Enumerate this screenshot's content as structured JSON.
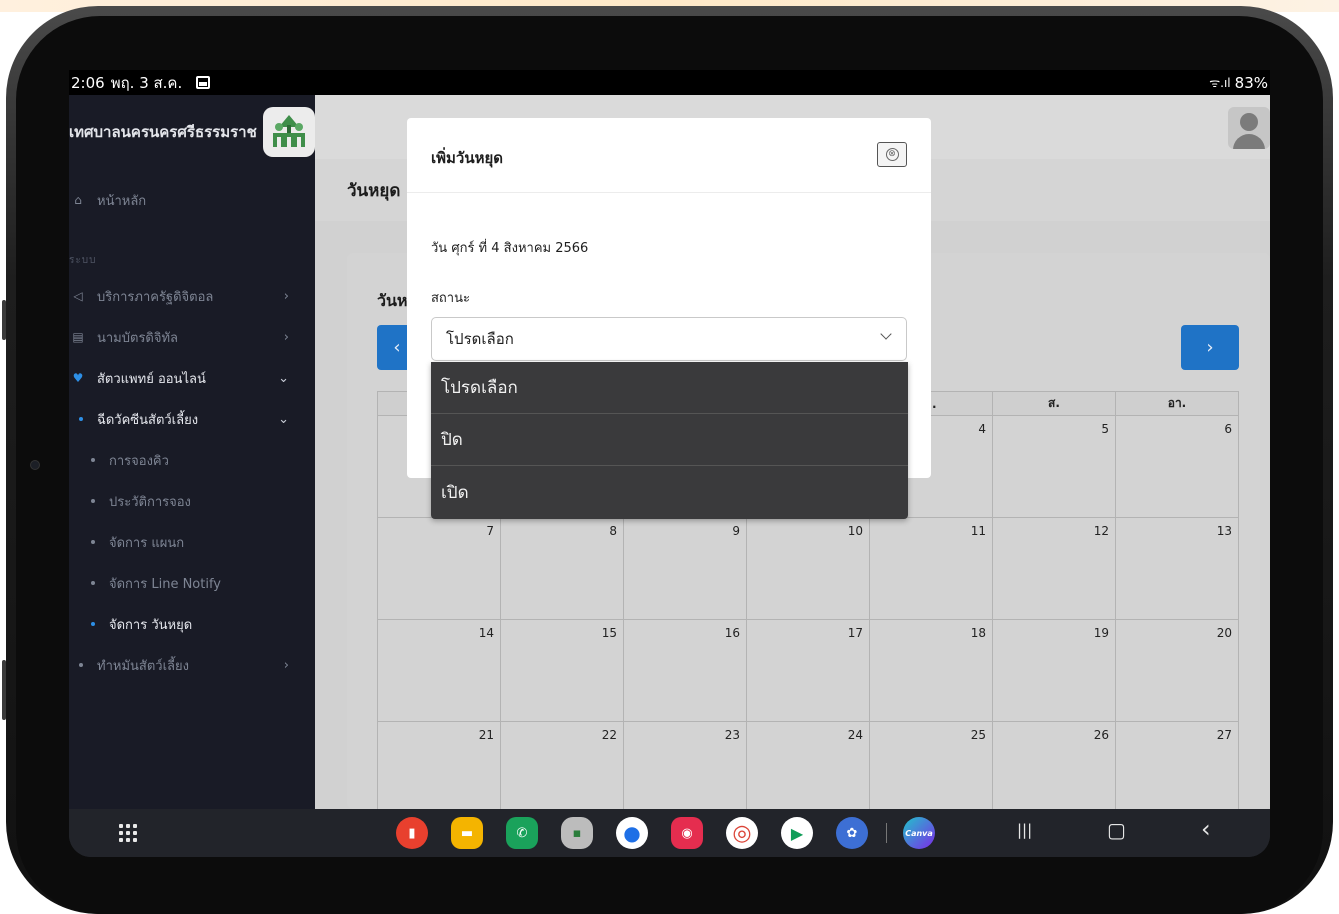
{
  "status_bar": {
    "time": "2:06",
    "date": "พฤ. 3 ส.ค.",
    "signal": "ᯤ.ıl",
    "battery": "83%"
  },
  "sidebar": {
    "brand": "เทศบาลนครนครศรีธรรมราช",
    "home": "หน้าหลัก",
    "section": "ระบบ",
    "items": [
      {
        "label": "บริการภาครัฐดิจิตอล",
        "expanded": false
      },
      {
        "label": "นามบัตรดิจิทัล",
        "expanded": false
      },
      {
        "label": "สัตวแพทย์ ออนไลน์",
        "expanded": true
      },
      {
        "label": "ฉีดวัคซีนสัตว์เลี้ยง",
        "expanded": true
      }
    ],
    "subitems": [
      "การจองคิว",
      "ประวัติการจอง",
      "จัดการ แผนก",
      "จัดการ Line Notify",
      "จัดการ วันหยุด"
    ],
    "last_item": "ทำหมันสัตว์เลี้ยง"
  },
  "page": {
    "title": "วันหยุด",
    "card_title": "วันห",
    "prev_label": "‹",
    "next_label": "›"
  },
  "calendar": {
    "headers": [
      "",
      "",
      "",
      "",
      ".",
      "ส.",
      "อา."
    ],
    "rows": [
      [
        "",
        "",
        "",
        "",
        "4",
        "5",
        "6"
      ],
      [
        "7",
        "8",
        "9",
        "10",
        "11",
        "12",
        "13"
      ],
      [
        "14",
        "15",
        "16",
        "17",
        "18",
        "19",
        "20"
      ],
      [
        "21",
        "22",
        "23",
        "24",
        "25",
        "26",
        "27"
      ]
    ]
  },
  "modal": {
    "title": "เพิ่มวันหยุด",
    "close_symbol": "⊗",
    "date_text": "วัน ศุกร์ ที่ 4 สิงหาคม 2566",
    "status_label": "สถานะ",
    "select_value": "โปรดเลือก",
    "options": [
      "โปรดเลือก",
      "ปิด",
      "เปิด"
    ]
  },
  "dock": {
    "canva_label": "Canva",
    "apps": [
      {
        "name": "notes",
        "color": "#e8402e",
        "glyph": "▮"
      },
      {
        "name": "files",
        "color": "#f4b400",
        "glyph": "▬"
      },
      {
        "name": "phone",
        "color": "#1aa25b",
        "glyph": "✆"
      },
      {
        "name": "gallery-group",
        "color": "#bcbcbc",
        "glyph": "▪"
      },
      {
        "name": "messages",
        "color": "#1e6fe6",
        "glyph": "●"
      },
      {
        "name": "camera",
        "color": "#e52d4f",
        "glyph": "◉"
      },
      {
        "name": "chrome",
        "color": "#ffffff",
        "glyph": "◎"
      },
      {
        "name": "play-store",
        "color": "#ffffff",
        "glyph": "▶"
      },
      {
        "name": "settings",
        "color": "#3d6fd4",
        "glyph": "✿"
      }
    ],
    "recents": "|||",
    "home": "▢",
    "back": "‹"
  },
  "colors": {
    "accent": "#1f73c6",
    "sidebar_bg": "#191b26",
    "active_dot": "#2d8fe6"
  }
}
